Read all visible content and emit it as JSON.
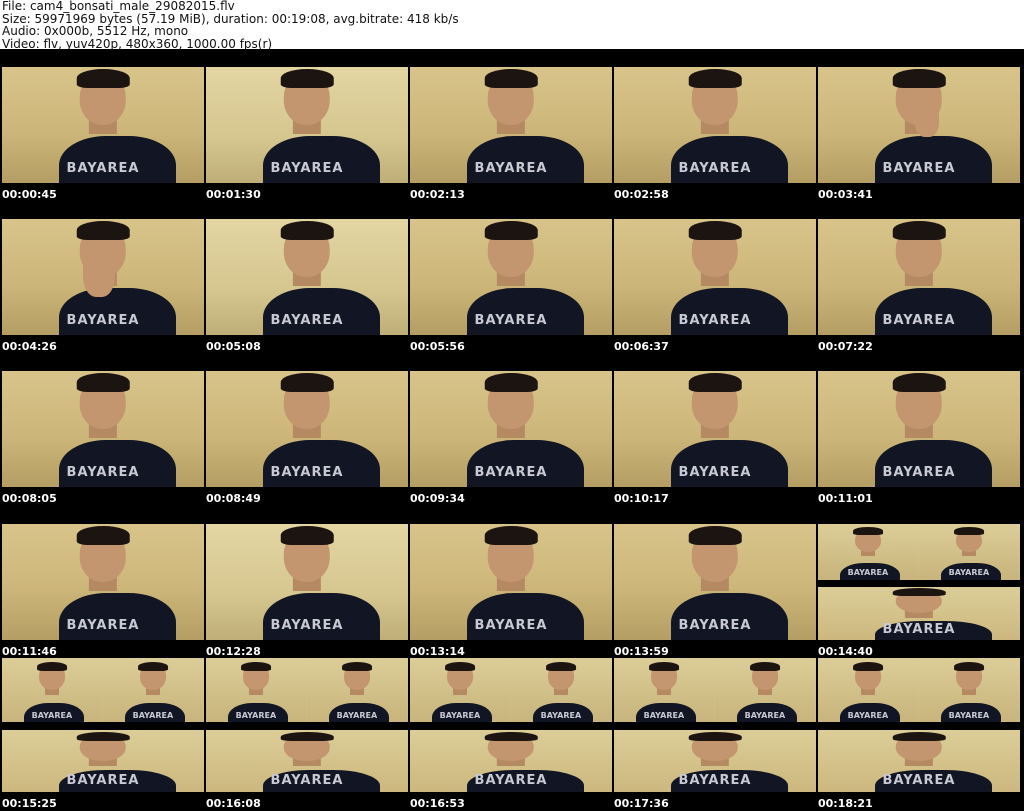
{
  "header": {
    "file": "File: cam4_bonsati_male_29082015.flv",
    "size": "Size: 59971969 bytes (57.19 MiB), duration: 00:19:08, avg.bitrate: 418 kb/s",
    "audio": "Audio: 0x000b, 5512 Hz, mono",
    "video": "Video: flv, yuv420p, 480x360, 1000.00 fps(r)"
  },
  "shirt_text": "BAYAREA",
  "thumbnails": [
    {
      "time": "00:00:45"
    },
    {
      "time": "00:01:30"
    },
    {
      "time": "00:02:13"
    },
    {
      "time": "00:02:58"
    },
    {
      "time": "00:03:41"
    },
    {
      "time": "00:04:26"
    },
    {
      "time": "00:05:08"
    },
    {
      "time": "00:05:56"
    },
    {
      "time": "00:06:37"
    },
    {
      "time": "00:07:22"
    },
    {
      "time": "00:08:05"
    },
    {
      "time": "00:08:49"
    },
    {
      "time": "00:09:34"
    },
    {
      "time": "00:10:17"
    },
    {
      "time": "00:11:01"
    },
    {
      "time": "00:11:46"
    },
    {
      "time": "00:12:28"
    },
    {
      "time": "00:13:14"
    },
    {
      "time": "00:13:59"
    },
    {
      "time": "00:14:40"
    },
    {
      "time": "00:15:25"
    },
    {
      "time": "00:16:08"
    },
    {
      "time": "00:16:53"
    },
    {
      "time": "00:17:36"
    },
    {
      "time": "00:18:21"
    }
  ]
}
